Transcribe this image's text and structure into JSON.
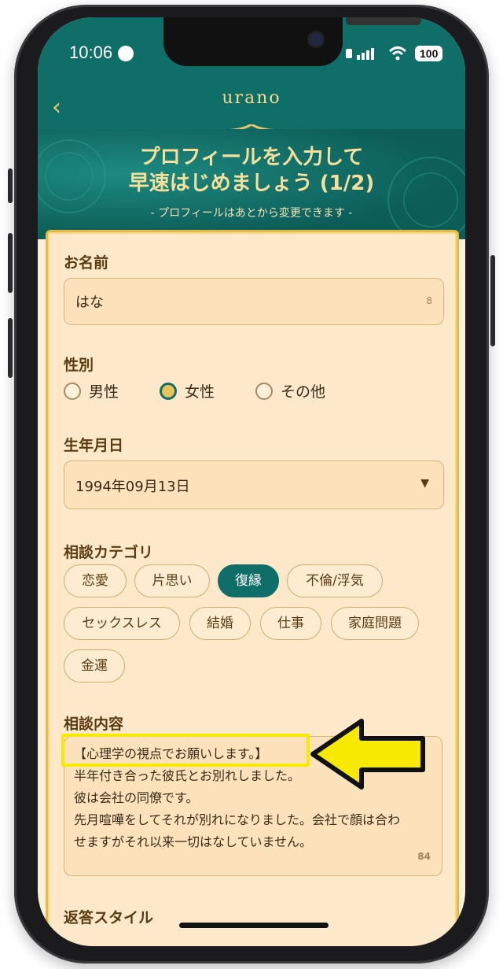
{
  "status_bar": {
    "time": "10:06",
    "battery": "100"
  },
  "header": {
    "back": "‹",
    "logo": "urano"
  },
  "hero": {
    "title_line1": "プロフィールを入力して",
    "title_line2": "早速はじめましょう (1/2)",
    "subtitle": "- プロフィールはあとから変更できます -"
  },
  "form": {
    "name": {
      "label": "お名前",
      "value": "はな",
      "counter": "8"
    },
    "gender": {
      "label": "性別",
      "options": [
        "男性",
        "女性",
        "その他"
      ],
      "selected": "女性"
    },
    "birthday": {
      "label": "生年月日",
      "value": "1994年09月13日"
    },
    "category": {
      "label": "相談カテゴリ",
      "tags": [
        "恋愛",
        "片思い",
        "復縁",
        "不倫/浮気",
        "セックスレス",
        "結婚",
        "仕事",
        "家庭問題",
        "金運"
      ],
      "selected": "復縁"
    },
    "content": {
      "label": "相談内容",
      "lines": [
        "【心理学の視点でお願いします。】",
        "半年付き合った彼氏とお別れしました。",
        "彼は会社の同僚です。",
        "先月喧嘩をしてそれが別れになりました。会社で顔は合わ",
        "せますがそれ以来一切はなしていません。"
      ],
      "counter": "84"
    },
    "reply_style": {
      "label": "返答スタイル"
    }
  },
  "colors": {
    "teal": "#0f6e67",
    "gold": "#e5b94a",
    "cream": "#fde9c9",
    "highlight": "#f7ea00"
  }
}
